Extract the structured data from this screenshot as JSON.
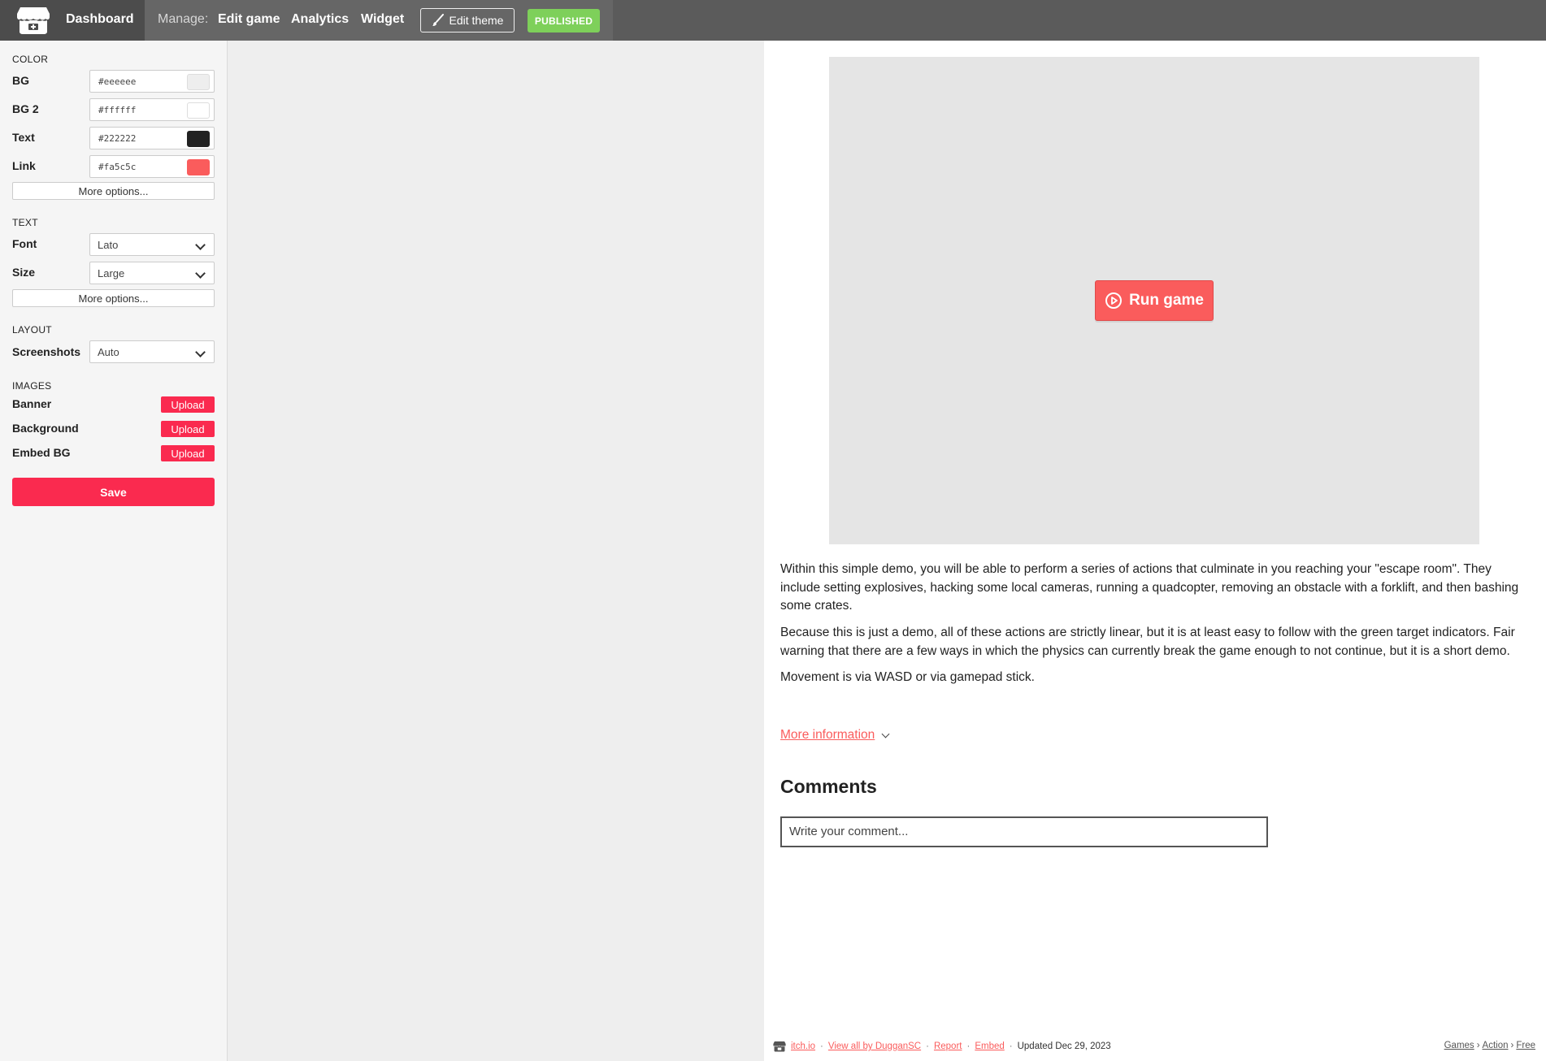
{
  "topbar": {
    "dashboard_label": "Dashboard",
    "manage_label": "Manage:",
    "nav": {
      "edit_game": "Edit game",
      "analytics": "Analytics",
      "widget": "Widget"
    },
    "edit_theme_label": "Edit theme",
    "published_label": "PUBLISHED"
  },
  "sidebar": {
    "color": {
      "title": "COLOR",
      "rows": [
        {
          "label": "BG",
          "hex": "#eeeeee",
          "swatch": "#eeeeee"
        },
        {
          "label": "BG 2",
          "hex": "#ffffff",
          "swatch": "#ffffff"
        },
        {
          "label": "Text",
          "hex": "#222222",
          "swatch": "#222222"
        },
        {
          "label": "Link",
          "hex": "#fa5c5c",
          "swatch": "#fa5c5c"
        }
      ],
      "more_label": "More options..."
    },
    "text": {
      "title": "TEXT",
      "font_label": "Font",
      "font_value": "Lato",
      "size_label": "Size",
      "size_value": "Large",
      "more_label": "More options..."
    },
    "layout": {
      "title": "LAYOUT",
      "screenshots_label": "Screenshots",
      "screenshots_value": "Auto"
    },
    "images": {
      "title": "IMAGES",
      "rows": [
        {
          "label": "Banner",
          "button": "Upload"
        },
        {
          "label": "Background",
          "button": "Upload"
        },
        {
          "label": "Embed BG",
          "button": "Upload"
        }
      ]
    },
    "save_label": "Save"
  },
  "content": {
    "run_game_label": "Run game",
    "paragraphs": [
      "Within this simple demo, you will be able to perform a series of actions that culminate in you reaching your \"escape room\". They include setting explosives, hacking some local cameras, running a quadcopter, removing an obstacle with a forklift, and then bashing some crates.",
      "Because this is just a demo, all of these actions are strictly linear, but it is at least easy to follow with the green target indicators. Fair warning that there are a few ways in which the physics can currently break the game enough to not continue, but it is a short demo.",
      "Movement is via WASD or via gamepad stick."
    ],
    "more_information_label": "More information",
    "comments_title": "Comments",
    "comment_placeholder": "Write your comment..."
  },
  "footer": {
    "links": [
      "itch.io",
      "View all by DugganSC",
      "Report",
      "Embed"
    ],
    "updated": "Updated Dec 29, 2023",
    "breadcrumbs": [
      "Games",
      "Action",
      "Free"
    ]
  },
  "colors": {
    "accent": "#fa2a4f",
    "link": "#fa5c5c",
    "published": "#7ed05a",
    "topbar": "#5b5b5b"
  }
}
